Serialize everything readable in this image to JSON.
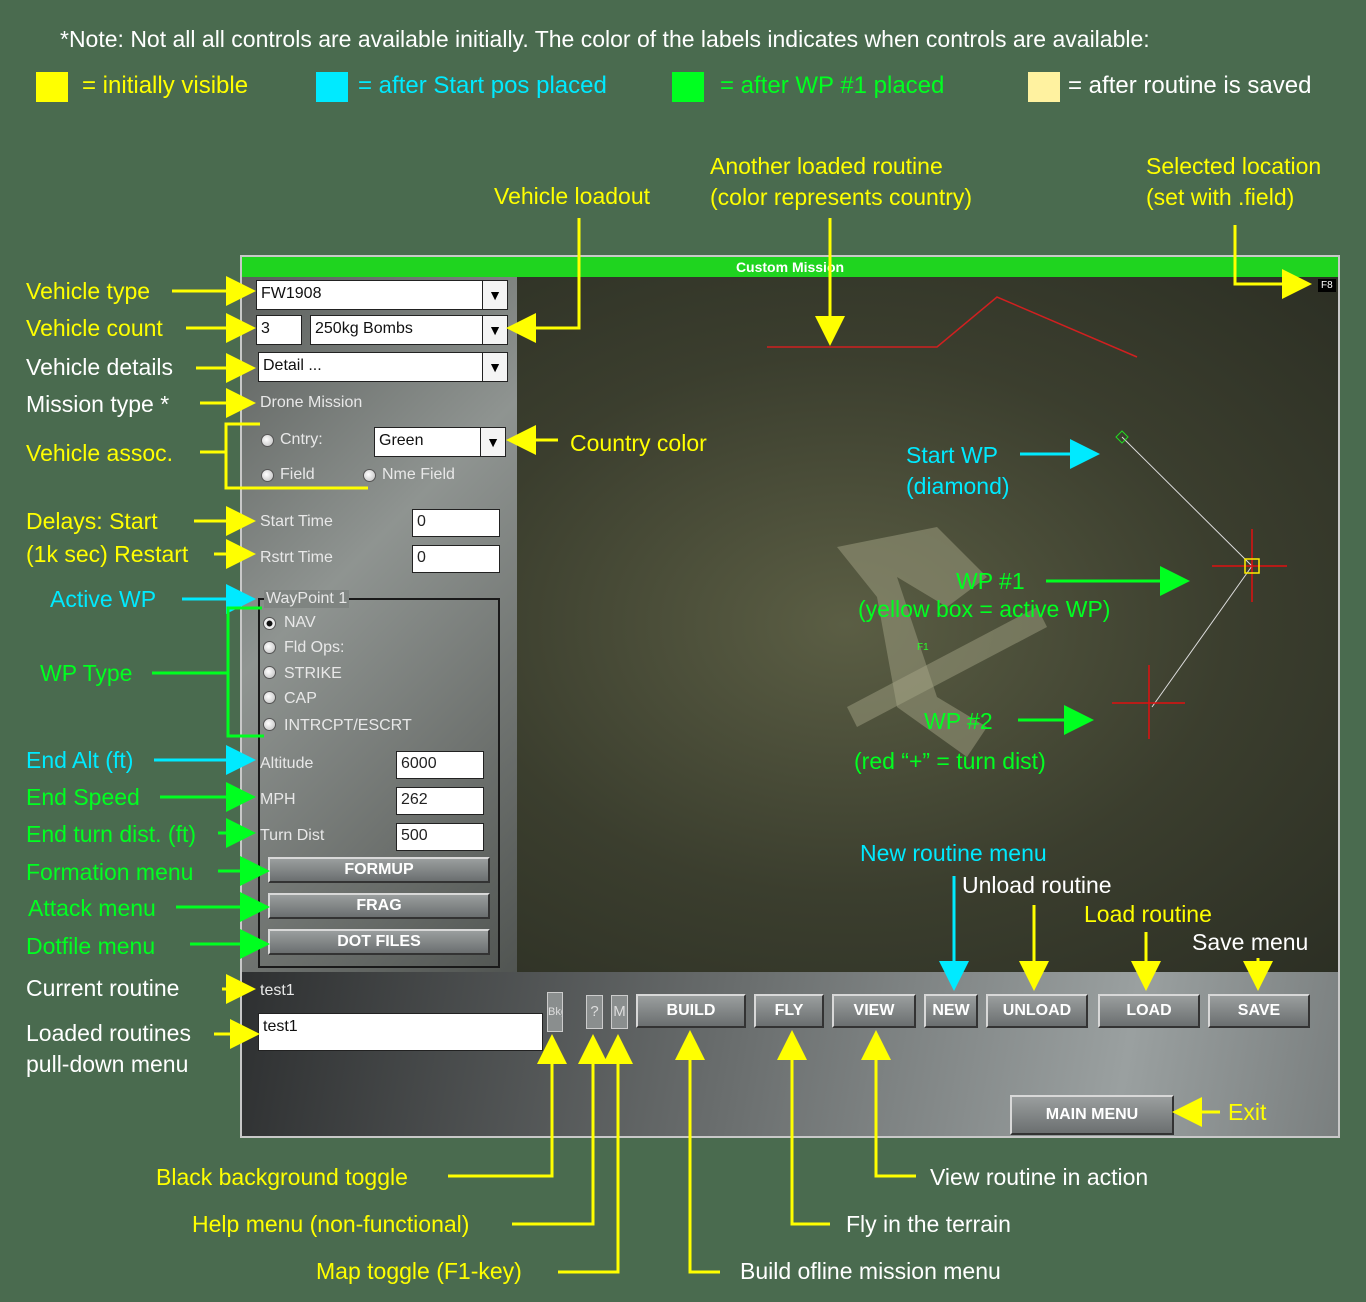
{
  "note": "*Note: Not all all controls are available initially.  The color of the labels indicates when controls are available:",
  "legend": [
    {
      "color": "#ffff00",
      "text": "= initially visible"
    },
    {
      "color": "#00eaff",
      "text": "= after Start pos placed"
    },
    {
      "color": "#00ff20",
      "text": "= after WP #1 placed"
    },
    {
      "color": "#fff2a0",
      "text": "= after routine is saved"
    }
  ],
  "window": {
    "title": "Custom Mission",
    "f8": "F8",
    "vehicle_type": "FW1908",
    "vehicle_count": "3",
    "loadout": "250kg Bombs",
    "details": "Detail ...",
    "mission_type": "Drone Mission",
    "cntry_label": "Cntry:",
    "country": "Green",
    "field_label": "Field",
    "nme_field_label": "Nme Field",
    "start_time_label": "Start Time",
    "start_time": "0",
    "rstrt_time_label": "Rstrt Time",
    "rstrt_time": "0",
    "waypoint_group": "WayPoint 1",
    "wp_types": [
      "NAV",
      "Fld Ops:",
      "STRIKE",
      "CAP",
      "INTRCPT/ESCRT"
    ],
    "altitude_label": "Altitude",
    "altitude": "6000",
    "mph_label": "MPH",
    "mph": "262",
    "turn_dist_label": "Turn Dist",
    "turn_dist": "500",
    "formup": "FORMUP",
    "frag": "FRAG",
    "dot_files": "DOT FILES",
    "current_routine": "test1",
    "loaded_routine": "test1",
    "bkg": "Bkg",
    "help": "?",
    "map_toggle": "M",
    "build": "BUILD",
    "fly": "FLY",
    "view": "VIEW",
    "new": "NEW",
    "unload": "UNLOAD",
    "load": "LOAD",
    "save": "SAVE",
    "main_menu": "MAIN MENU",
    "field_marker": "F1"
  },
  "annotations": {
    "vehicle_type": "Vehicle type",
    "vehicle_count": "Vehicle count",
    "vehicle_details": "Vehicle details",
    "mission_type": "Mission type *",
    "vehicle_assoc": "Vehicle assoc.",
    "delays_start": "Delays:  Start",
    "delays_restart": "(1k sec)  Restart",
    "active_wp": "Active WP",
    "wp_type": "WP Type",
    "end_alt": "End Alt (ft)",
    "end_speed": "End Speed",
    "end_turn": "End turn dist. (ft)",
    "formation": "Formation menu",
    "attack": "Attack menu",
    "dotfile": "Dotfile menu",
    "current_routine": "Current routine",
    "loaded_routines_1": "Loaded routines",
    "loaded_routines_2": "pull-down menu",
    "vehicle_loadout": "Vehicle loadout",
    "another_1": "Another loaded routine",
    "another_2": "(color represents country)",
    "selected_1": "Selected location",
    "selected_2": "(set with .field)",
    "country_color": "Country color",
    "start_wp_1": "Start WP",
    "start_wp_2": "(diamond)",
    "wp1_1": "WP #1",
    "wp1_2": "(yellow box = active WP)",
    "wp2_1": "WP #2",
    "wp2_2": "(red “+” = turn dist)",
    "new_menu": "New routine menu",
    "unload": "Unload routine",
    "load": "Load routine",
    "save": "Save menu",
    "exit": "Exit",
    "bkg_toggle": "Black background toggle",
    "help_menu": "Help menu (non-functional)",
    "map_toggle": "Map toggle (F1-key)",
    "view_action": "View routine in action",
    "fly_terrain": "Fly in the terrain",
    "build_menu": "Build ofline mission menu"
  }
}
